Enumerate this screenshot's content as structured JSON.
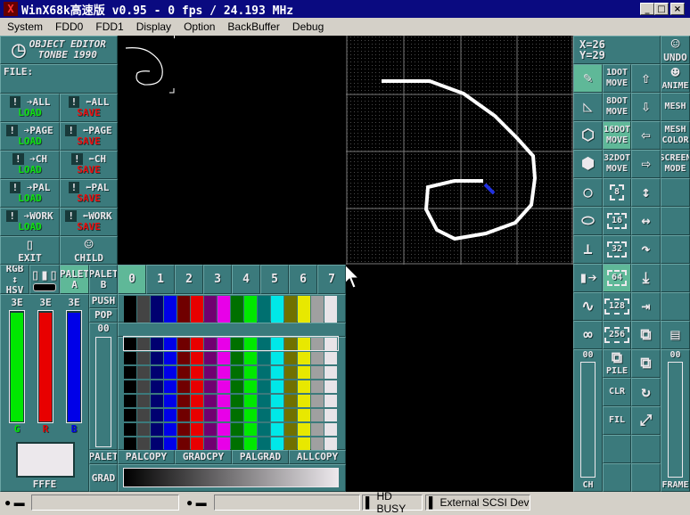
{
  "title_bar": {
    "title": "WinX68k高速版 v0.95 - 0 fps / 24.193 MHz",
    "minimize": "_",
    "maximize": "□",
    "close": "×"
  },
  "menu": [
    "System",
    "FDD0",
    "FDD1",
    "Display",
    "Option",
    "BackBuffer",
    "Debug"
  ],
  "left_panel": {
    "logo": [
      "OBJECT EDITOR",
      "TONBE 1990"
    ],
    "file_label": "FILE:",
    "load_save": [
      {
        "target": "ALL",
        "load": "LOAD",
        "save": "SAVE"
      },
      {
        "target": "PAGE",
        "load": "LOAD",
        "save": "SAVE"
      },
      {
        "target": "CH",
        "load": "LOAD",
        "save": "SAVE"
      },
      {
        "target": "PAL",
        "load": "LOAD",
        "save": "SAVE"
      },
      {
        "target": "WORK",
        "load": "LOAD",
        "save": "SAVE"
      }
    ],
    "exit": "EXIT",
    "child": "CHILD",
    "rgb": "RGB",
    "hsv": "HSV",
    "palet_a": "PALET A",
    "palet_b": "PALET B",
    "sliders": [
      {
        "value": "3E",
        "label": "G",
        "color": "#00e800",
        "level": 0.98
      },
      {
        "value": "3E",
        "label": "R",
        "color": "#e80000",
        "level": 0.98
      },
      {
        "value": "3E",
        "label": "B",
        "color": "#0000e8",
        "level": 0.98
      }
    ],
    "color_value": "FFFE",
    "push": "PUSH",
    "pop": "POP",
    "palet_slider_value": "00",
    "palet_label": "PALET",
    "grad_label": "GRAD"
  },
  "palette": {
    "tabs": [
      "0",
      "1",
      "2",
      "3",
      "4",
      "5",
      "6",
      "7"
    ],
    "active_tab": 0,
    "colors": [
      "#000000",
      "#444444",
      "#000070",
      "#0000e8",
      "#700000",
      "#e80000",
      "#700070",
      "#e800e8",
      "#007000",
      "#00e800",
      "#007070",
      "#00e8e8",
      "#707000",
      "#e8e800",
      "#a0a0a0",
      "#e8e4e8"
    ],
    "buttons": [
      "PALCOPY",
      "GRADCPY",
      "PALGRAD",
      "ALLCOPY"
    ]
  },
  "right_panel": {
    "x": "X=26",
    "y": "Y=29",
    "undo": "UNDO",
    "rows": [
      [
        {
          "n": "pencil",
          "i": "✎",
          "a": true
        },
        {
          "n": "1dot-move",
          "t": "1DOT MOVE"
        },
        {
          "n": "up",
          "i": "⇧"
        },
        {
          "n": "anime",
          "i": "☻",
          "t": "ANIME"
        }
      ],
      [
        {
          "n": "triangle",
          "i": "◺"
        },
        {
          "n": "8dot-move",
          "t": "8DOT MOVE"
        },
        {
          "n": "down",
          "i": "⇩"
        },
        {
          "n": "mesh",
          "t": "MESH"
        }
      ],
      [
        {
          "n": "wire-cube",
          "i": "⬡"
        },
        {
          "n": "16dot-move",
          "t": "16DOT MOVE",
          "a": true
        },
        {
          "n": "left",
          "i": "⇦"
        },
        {
          "n": "mesh-color",
          "t": "MESH COLOR"
        }
      ],
      [
        {
          "n": "solid-cube",
          "i": "⬢"
        },
        {
          "n": "32dot-move",
          "t": "32DOT MOVE"
        },
        {
          "n": "right",
          "i": "⇨"
        },
        {
          "n": "screen-mode",
          "t": "SCREEN MODE"
        }
      ],
      [
        {
          "n": "circle",
          "i": "○"
        },
        {
          "n": "size-8",
          "f": "8"
        },
        {
          "n": "flip-vertical",
          "i": "↕"
        },
        {
          "n": "empty"
        }
      ],
      [
        {
          "n": "ellipse",
          "i": "⬭"
        },
        {
          "n": "size-16",
          "f": "16"
        },
        {
          "n": "flip-horizontal",
          "i": "↔"
        },
        {
          "n": "empty"
        }
      ],
      [
        {
          "n": "stamp",
          "i": "⊥"
        },
        {
          "n": "size-32",
          "f": "32"
        },
        {
          "n": "rotate-right",
          "i": "↷"
        },
        {
          "n": "empty"
        }
      ],
      [
        {
          "n": "fill-bar",
          "i": "▮➔"
        },
        {
          "n": "size-64",
          "f": "64",
          "a": true
        },
        {
          "n": "shift-down",
          "i": "⤓"
        },
        {
          "n": "empty"
        }
      ],
      [
        {
          "n": "wave",
          "i": "∿"
        },
        {
          "n": "size-128",
          "f": "128"
        },
        {
          "n": "shift-right",
          "i": "⇥"
        },
        {
          "n": "empty"
        }
      ],
      [
        {
          "n": "loop",
          "i": "∞"
        },
        {
          "n": "size-256",
          "f": "256"
        },
        {
          "n": "copy",
          "i": "⧉"
        },
        {
          "n": "film",
          "i": "▤"
        }
      ]
    ],
    "ch_value": "00",
    "ch_label": "CH",
    "frame_value": "00",
    "frame_label": "FRAME",
    "tools": [
      [
        {
          "n": "pile",
          "i": "⧉",
          "t": "PILE"
        },
        {
          "n": "copy-2",
          "i": "⧉"
        }
      ],
      [
        {
          "n": "clear",
          "t": "CLR"
        },
        {
          "n": "rotate",
          "i": "↻"
        }
      ],
      [
        {
          "n": "fill",
          "t": "FIL"
        },
        {
          "n": "expand",
          "i": "⤢"
        }
      ],
      [
        {
          "n": "empty"
        },
        {
          "n": "empty"
        }
      ],
      [
        {
          "n": "empty"
        },
        {
          "n": "empty"
        }
      ]
    ]
  },
  "status_bar": {
    "hd": "HD BUSY",
    "scsi": "External SCSI Devic"
  }
}
